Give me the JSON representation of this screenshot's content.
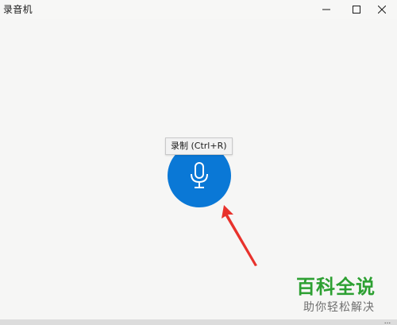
{
  "window": {
    "title": "录音机"
  },
  "record": {
    "tooltip": "录制 (Ctrl+R)",
    "accent_color": "#0a78d6",
    "icon": "microphone-icon"
  },
  "annotation": {
    "arrow_color": "#e8322c"
  },
  "watermark": {
    "title": "百科全说",
    "subtitle": "助你轻松解决"
  },
  "bottom_bar": {
    "more_label": "..."
  }
}
